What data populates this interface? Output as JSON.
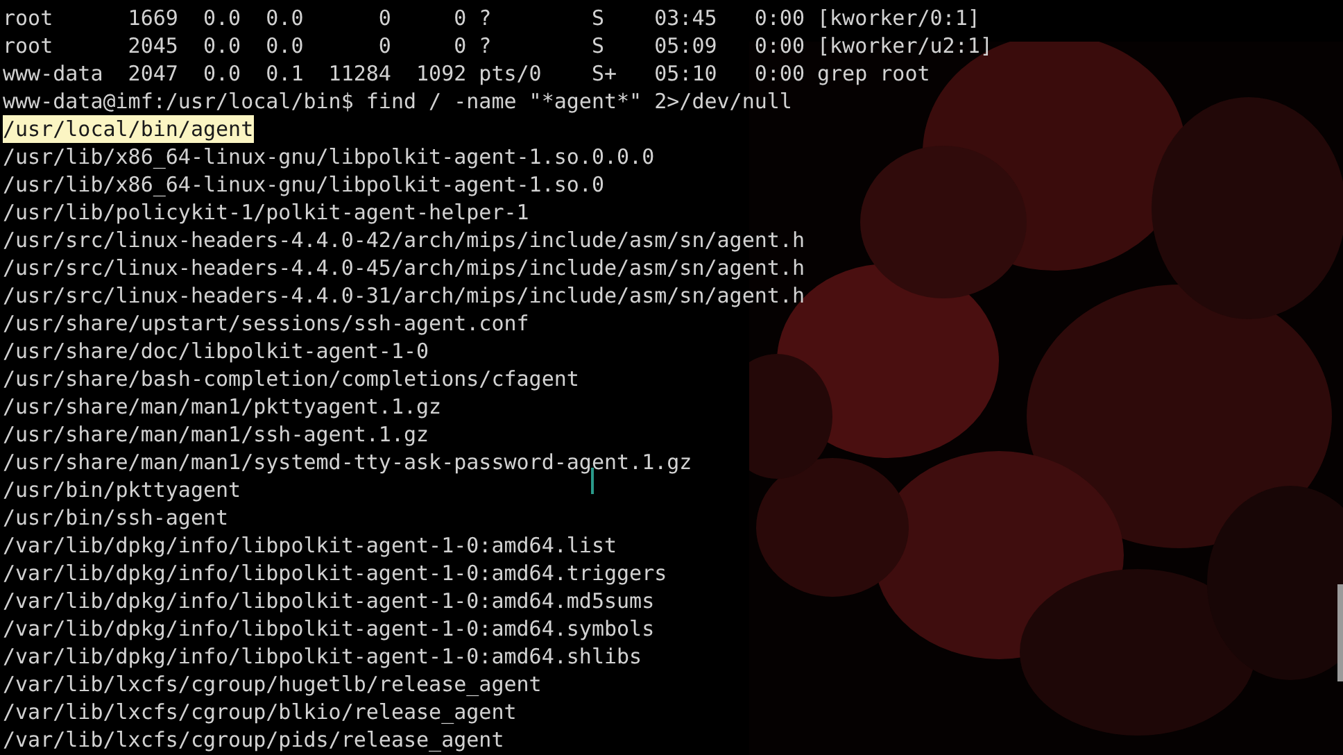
{
  "ps_rows": [
    "root      1669  0.0  0.0      0     0 ?        S    03:45   0:00 [kworker/0:1]",
    "root      2045  0.0  0.0      0     0 ?        S    05:09   0:00 [kworker/u2:1]",
    "www-data  2047  0.0  0.1  11284  1092 pts/0    S+   05:10   0:00 grep root"
  ],
  "prompt_line": "www-data@imf:/usr/local/bin$ find / -name \"*agent*\" 2>/dev/null",
  "output_lines": [
    {
      "text": "/usr/local/bin/agent",
      "highlighted": true
    },
    {
      "text": "/usr/lib/x86_64-linux-gnu/libpolkit-agent-1.so.0.0.0",
      "highlighted": false
    },
    {
      "text": "/usr/lib/x86_64-linux-gnu/libpolkit-agent-1.so.0",
      "highlighted": false
    },
    {
      "text": "/usr/lib/policykit-1/polkit-agent-helper-1",
      "highlighted": false
    },
    {
      "text": "/usr/src/linux-headers-4.4.0-42/arch/mips/include/asm/sn/agent.h",
      "highlighted": false
    },
    {
      "text": "/usr/src/linux-headers-4.4.0-45/arch/mips/include/asm/sn/agent.h",
      "highlighted": false
    },
    {
      "text": "/usr/src/linux-headers-4.4.0-31/arch/mips/include/asm/sn/agent.h",
      "highlighted": false
    },
    {
      "text": "/usr/share/upstart/sessions/ssh-agent.conf",
      "highlighted": false
    },
    {
      "text": "/usr/share/doc/libpolkit-agent-1-0",
      "highlighted": false
    },
    {
      "text": "/usr/share/bash-completion/completions/cfagent",
      "highlighted": false
    },
    {
      "text": "/usr/share/man/man1/pkttyagent.1.gz",
      "highlighted": false
    },
    {
      "text": "/usr/share/man/man1/ssh-agent.1.gz",
      "highlighted": false
    },
    {
      "text": "/usr/share/man/man1/systemd-tty-ask-password-agent.1.gz",
      "highlighted": false
    },
    {
      "text": "/usr/bin/pkttyagent",
      "highlighted": false
    },
    {
      "text": "/usr/bin/ssh-agent",
      "highlighted": false
    },
    {
      "text": "/var/lib/dpkg/info/libpolkit-agent-1-0:amd64.list",
      "highlighted": false
    },
    {
      "text": "/var/lib/dpkg/info/libpolkit-agent-1-0:amd64.triggers",
      "highlighted": false
    },
    {
      "text": "/var/lib/dpkg/info/libpolkit-agent-1-0:amd64.md5sums",
      "highlighted": false
    },
    {
      "text": "/var/lib/dpkg/info/libpolkit-agent-1-0:amd64.symbols",
      "highlighted": false
    },
    {
      "text": "/var/lib/dpkg/info/libpolkit-agent-1-0:amd64.shlibs",
      "highlighted": false
    },
    {
      "text": "/var/lib/lxcfs/cgroup/hugetlb/release_agent",
      "highlighted": false
    },
    {
      "text": "/var/lib/lxcfs/cgroup/blkio/release_agent",
      "highlighted": false
    },
    {
      "text": "/var/lib/lxcfs/cgroup/pids/release_agent",
      "highlighted": false
    }
  ]
}
